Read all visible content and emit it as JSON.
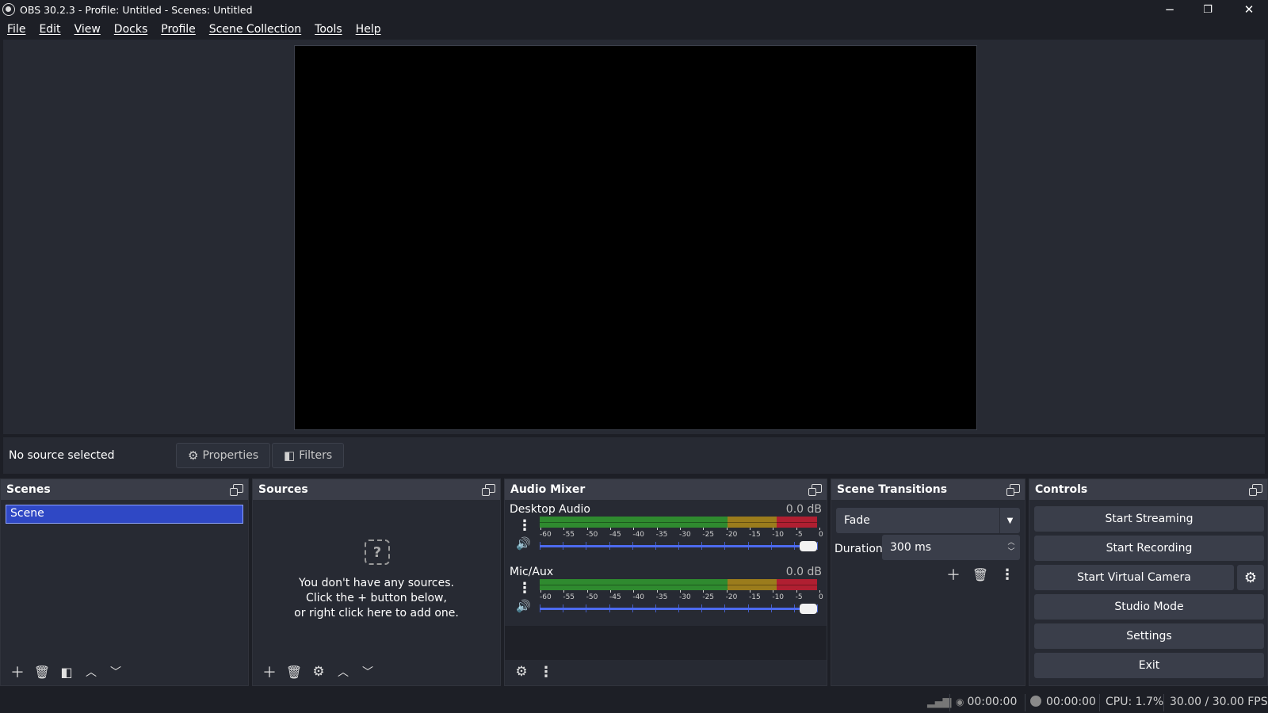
{
  "window": {
    "title": "OBS 30.2.3 - Profile: Untitled - Scenes: Untitled",
    "minimize": "−",
    "maximize": "❐",
    "close": "✕"
  },
  "menu": [
    "File",
    "Edit",
    "View",
    "Docks",
    "Profile",
    "Scene Collection",
    "Tools",
    "Help"
  ],
  "context_bar": {
    "no_source": "No source selected",
    "properties": "Properties",
    "filters": "Filters"
  },
  "scenes": {
    "title": "Scenes",
    "items": [
      "Scene"
    ]
  },
  "sources": {
    "title": "Sources",
    "empty_line1": "You don't have any sources.",
    "empty_line2": "Click the + button below,",
    "empty_line3": "or right click here to add one."
  },
  "audio_mixer": {
    "title": "Audio Mixer",
    "channels": [
      {
        "name": "Desktop Audio",
        "db": "0.0 dB",
        "volume_fraction": 1.0
      },
      {
        "name": "Mic/Aux",
        "db": "0.0 dB",
        "volume_fraction": 1.0
      }
    ],
    "meter_ticks": [
      "-60",
      "-55",
      "-50",
      "-45",
      "-40",
      "-35",
      "-30",
      "-25",
      "-20",
      "-15",
      "-10",
      "-5",
      "0"
    ],
    "meter_colors": {
      "green": "#2f8a2f",
      "yellow": "#9b7c1c",
      "red": "#b01f31"
    }
  },
  "transitions": {
    "title": "Scene Transitions",
    "selected": "Fade",
    "duration_label": "Duration",
    "duration_value": "300 ms"
  },
  "controls": {
    "title": "Controls",
    "start_streaming": "Start Streaming",
    "start_recording": "Start Recording",
    "start_virtual_camera": "Start Virtual Camera",
    "studio_mode": "Studio Mode",
    "settings": "Settings",
    "exit": "Exit"
  },
  "status": {
    "stream_time": "00:00:00",
    "record_time": "00:00:00",
    "cpu": "CPU: 1.7%",
    "fps": "30.00 / 30.00 FPS"
  },
  "icons": {
    "add": "plus-icon",
    "remove": "trash-icon",
    "filter": "filter-icon",
    "up": "chevron-up-icon",
    "down": "chevron-down-icon",
    "gear": "gear-icon",
    "menu": "kebab-menu-icon",
    "speaker": "speaker-icon"
  },
  "colors": {
    "accent": "#2f48c5",
    "volume": "#4d6bf0",
    "background": "#1d1f26",
    "panel": "#272a33"
  }
}
